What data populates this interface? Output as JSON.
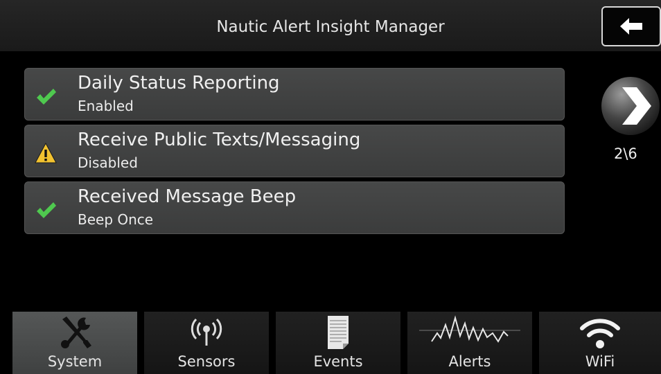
{
  "header": {
    "title": "Nautic Alert Insight Manager"
  },
  "settings": [
    {
      "title": "Daily Status Reporting",
      "value": "Enabled",
      "status": "ok",
      "icon": "checkmark-icon"
    },
    {
      "title": "Receive Public Texts/Messaging",
      "value": "Disabled",
      "status": "warning",
      "icon": "warning-icon"
    },
    {
      "title": "Received Message Beep",
      "value": "Beep Once",
      "status": "ok",
      "icon": "checkmark-icon"
    }
  ],
  "pagination": {
    "indicator": "2\\6"
  },
  "nav": {
    "tabs": [
      {
        "label": "System",
        "icon": "wrench-screwdriver-icon",
        "active": true
      },
      {
        "label": "Sensors",
        "icon": "antenna-signal-icon",
        "active": false
      },
      {
        "label": "Events",
        "icon": "document-icon",
        "active": false
      },
      {
        "label": "Alerts",
        "icon": "waveform-icon",
        "active": false
      },
      {
        "label": "WiFi",
        "icon": "wifi-icon",
        "active": false
      }
    ]
  },
  "colors": {
    "check": "#4fc94f",
    "warning": "#f2c230",
    "row_bg": "#424343",
    "active_tab": "#4c4e4e"
  }
}
